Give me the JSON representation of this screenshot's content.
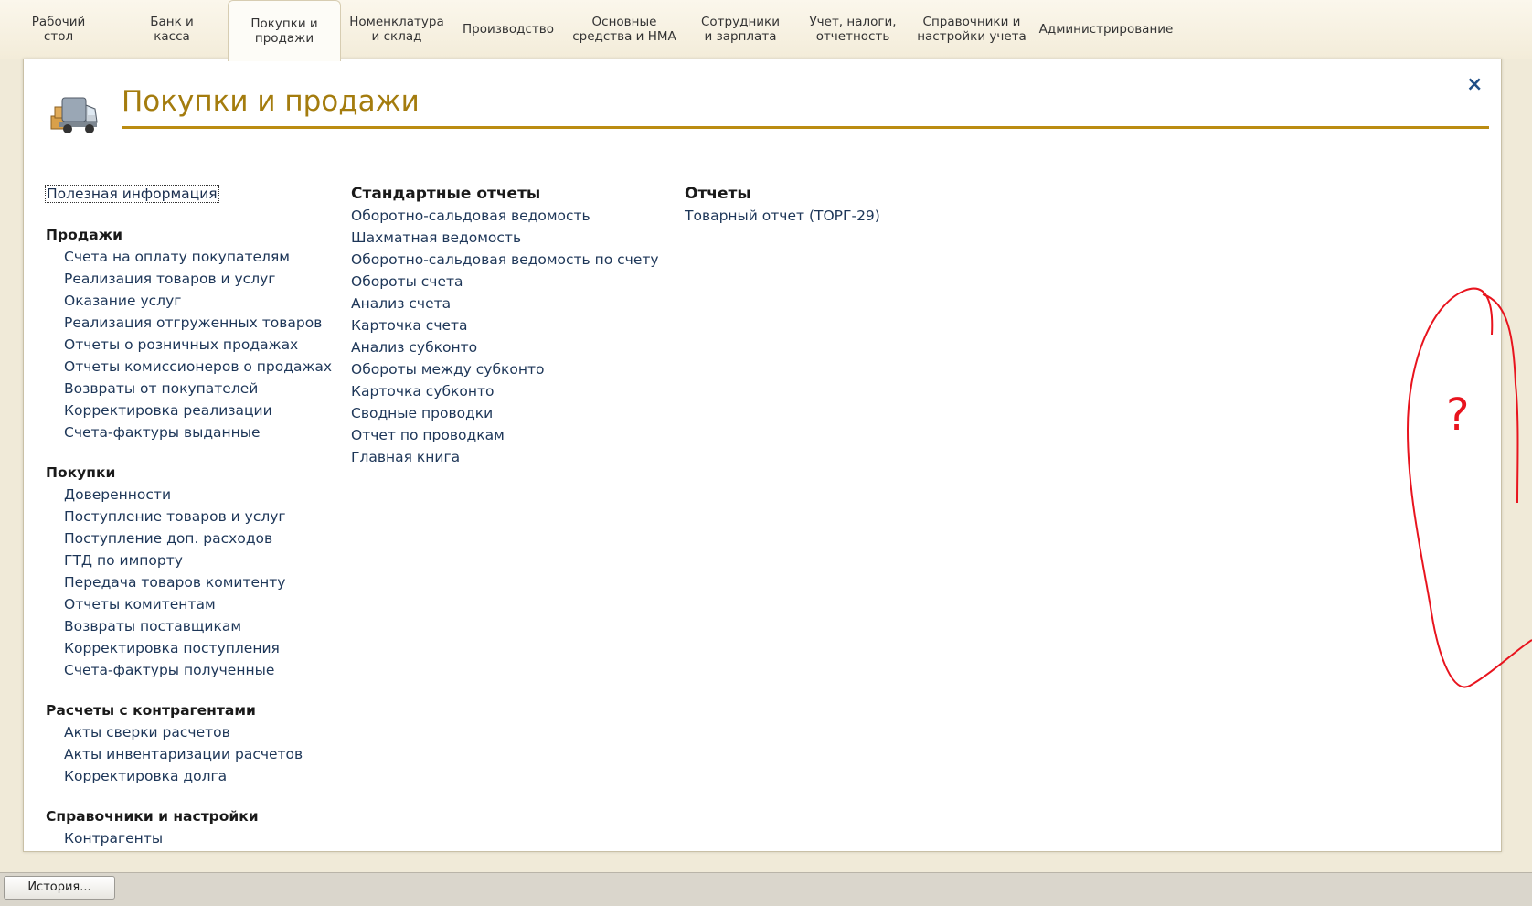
{
  "nav": {
    "tabs": [
      {
        "label": "Рабочий\nстол",
        "active": false
      },
      {
        "label": "Банк и\nкасса",
        "active": false
      },
      {
        "label": "Покупки и\nпродажи",
        "active": true
      },
      {
        "label": "Номенклатура\nи склад",
        "active": false
      },
      {
        "label": "Производство",
        "active": false
      },
      {
        "label": "Основные\nсредства и НМА",
        "active": false
      },
      {
        "label": "Сотрудники\nи зарплата",
        "active": false
      },
      {
        "label": "Учет, налоги,\nотчетность",
        "active": false
      },
      {
        "label": "Справочники и\nнастройки учета",
        "active": false
      },
      {
        "label": "Администрирование",
        "active": false
      }
    ]
  },
  "panel": {
    "title": "Покупки и продажи",
    "close_icon": "×",
    "logo_icon": "delivery-truck-icon",
    "useful_info": "Полезная информация"
  },
  "left_column": {
    "sections": [
      {
        "header": "Продажи",
        "items": [
          "Счета на оплату покупателям",
          "Реализация товаров и услуг",
          "Оказание услуг",
          "Реализация отгруженных товаров",
          "Отчеты о розничных продажах",
          "Отчеты комиссионеров о продажах",
          "Возвраты от покупателей",
          "Корректировка реализации",
          "Счета-фактуры выданные"
        ]
      },
      {
        "header": "Покупки",
        "items": [
          "Доверенности",
          "Поступление товаров и услуг",
          "Поступление доп. расходов",
          "ГТД по импорту",
          "Передача товаров комитенту",
          "Отчеты комитентам",
          "Возвраты поставщикам",
          "Корректировка поступления",
          "Счета-фактуры полученные"
        ]
      },
      {
        "header": "Расчеты с контрагентами",
        "items": [
          "Акты сверки расчетов",
          "Акты инвентаризации расчетов",
          "Корректировка долга"
        ]
      },
      {
        "header": "Справочники и настройки",
        "items": [
          "Контрагенты"
        ]
      }
    ]
  },
  "standard_reports": {
    "header": "Стандартные отчеты",
    "items": [
      "Оборотно-сальдовая ведомость",
      "Шахматная ведомость",
      "Оборотно-сальдовая ведомость по счету",
      "Обороты счета",
      "Анализ счета",
      "Карточка счета",
      "Анализ субконто",
      "Обороты между субконто",
      "Карточка субконто",
      "Сводные проводки",
      "Отчет по проводкам",
      "Главная книга"
    ]
  },
  "reports": {
    "header": "Отчеты",
    "items": [
      "Товарный отчет (ТОРГ-29)"
    ]
  },
  "bottom_bar": {
    "history_button": "История..."
  },
  "annotation": {
    "color": "#e8141e",
    "symbol": "?"
  }
}
